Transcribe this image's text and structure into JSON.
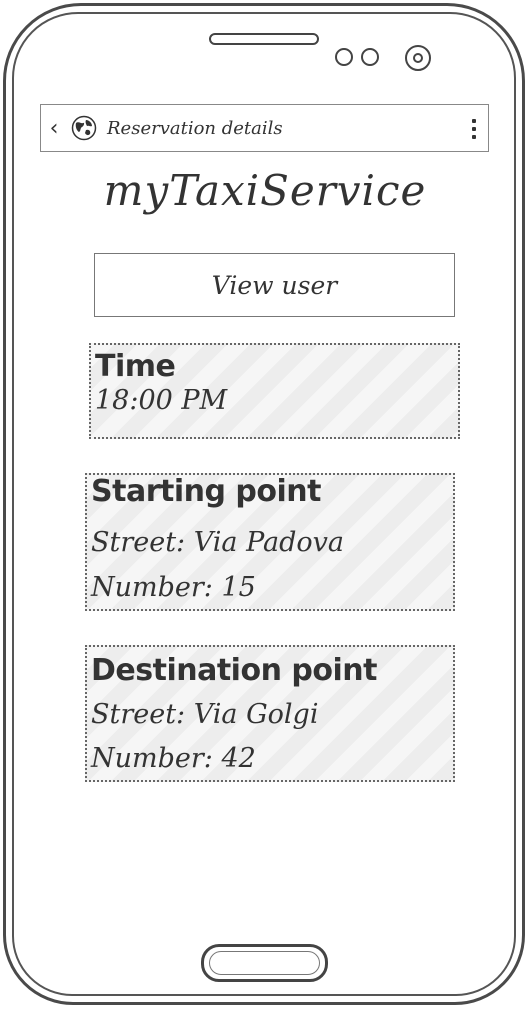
{
  "header": {
    "title": "Reservation details"
  },
  "app": {
    "name": "myTaxiService"
  },
  "actions": {
    "view_user_label": "View user"
  },
  "time_panel": {
    "heading": "Time",
    "value": "18:00 PM"
  },
  "starting_panel": {
    "heading": "Starting point",
    "street": "Street: Via Padova",
    "number": "Number: 15"
  },
  "destination_panel": {
    "heading": "Destination point",
    "street": "Street: Via Golgi",
    "number": "Number: 42"
  },
  "icons": {
    "back": "chevron-left-icon",
    "globe": "globe-icon",
    "menu": "more-vertical-icon"
  }
}
